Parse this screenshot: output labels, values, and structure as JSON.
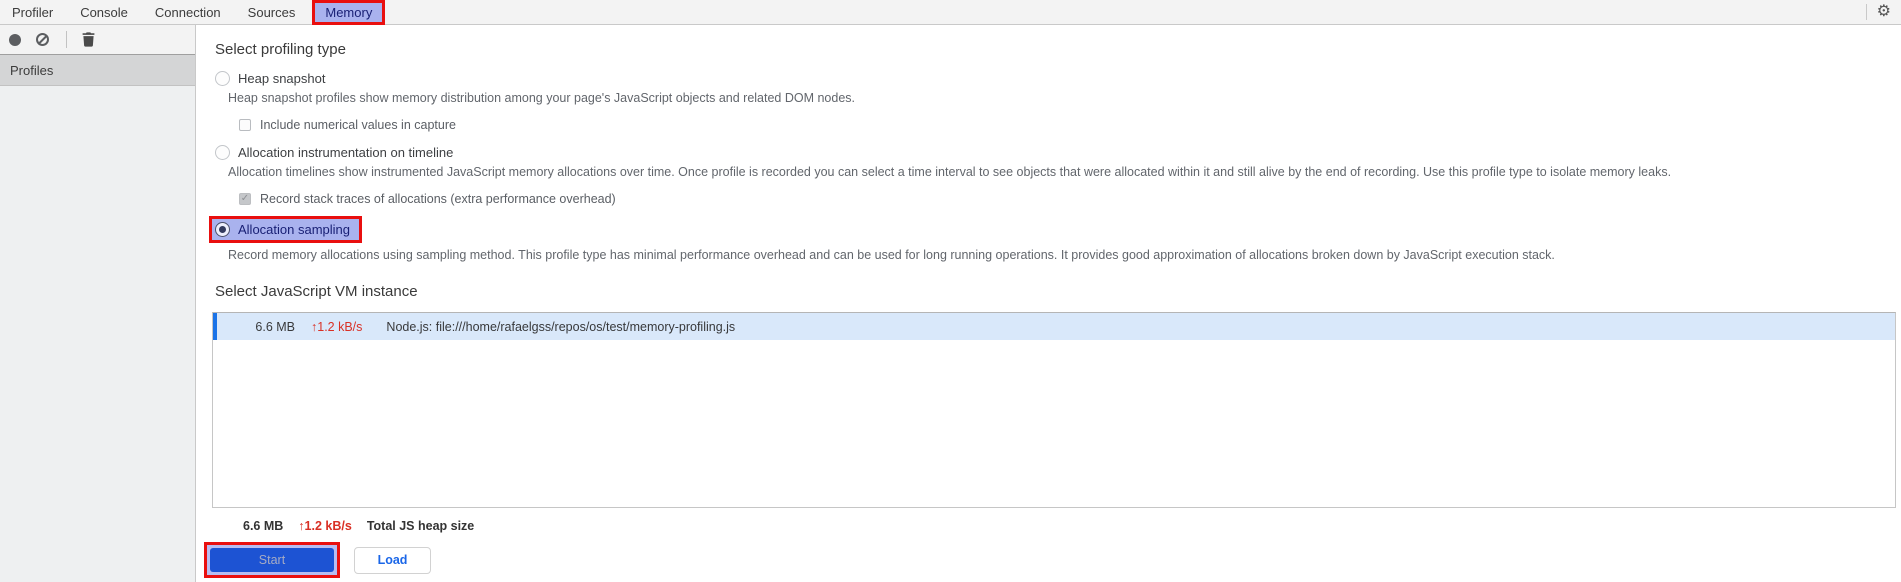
{
  "tabs": {
    "items": [
      "Profiler",
      "Console",
      "Connection",
      "Sources",
      "Memory"
    ],
    "active": "Memory"
  },
  "top_right_icons": [
    "gear-icon"
  ],
  "toolbar_icons": [
    "record-icon",
    "clear-icon",
    "trash-icon"
  ],
  "sidebar": {
    "header": "Profiles"
  },
  "main": {
    "profiling_type": {
      "heading": "Select profiling type",
      "options": [
        {
          "label": "Heap snapshot",
          "selected": false,
          "description": "Heap snapshot profiles show memory distribution among your page's JavaScript objects and related DOM nodes.",
          "checkbox": {
            "label": "Include numerical values in capture",
            "checked": false
          }
        },
        {
          "label": "Allocation instrumentation on timeline",
          "selected": false,
          "description": "Allocation timelines show instrumented JavaScript memory allocations over time. Once profile is recorded you can select a time interval to see objects that were allocated within it and still alive by the end of recording. Use this profile type to isolate memory leaks.",
          "checkbox": {
            "label": "Record stack traces of allocations (extra performance overhead)",
            "checked": true,
            "disabled": true
          }
        },
        {
          "label": "Allocation sampling",
          "selected": true,
          "highlighted": true,
          "description": "Record memory allocations using sampling method. This profile type has minimal performance overhead and can be used for long running operations. It provides good approximation of allocations broken down by JavaScript execution stack."
        }
      ]
    },
    "vm_instance": {
      "heading": "Select JavaScript VM instance",
      "rows": [
        {
          "size": "6.6 MB",
          "arrow": "↑",
          "rate": "1.2 kB/s",
          "name": "Node.js: file:///home/rafaelgss/repos/os/test/memory-profiling.js",
          "selected": true
        }
      ]
    },
    "summary": {
      "size": "6.6 MB",
      "arrow": "↑",
      "rate": "1.2 kB/s",
      "label": "Total JS heap size"
    },
    "actions": {
      "start_label": "Start",
      "load_label": "Load"
    }
  },
  "colors": {
    "annotation_red": "#e90f0f",
    "highlight_lavender": "#a9b2ee",
    "highlight_text_navy": "#181f74",
    "selected_row_blue": "#d9e8fa",
    "row_accent_blue": "#1a73e8",
    "rate_red": "#d93025",
    "start_button_blue": "#1d53d3",
    "load_text_blue": "#1a66e8"
  }
}
